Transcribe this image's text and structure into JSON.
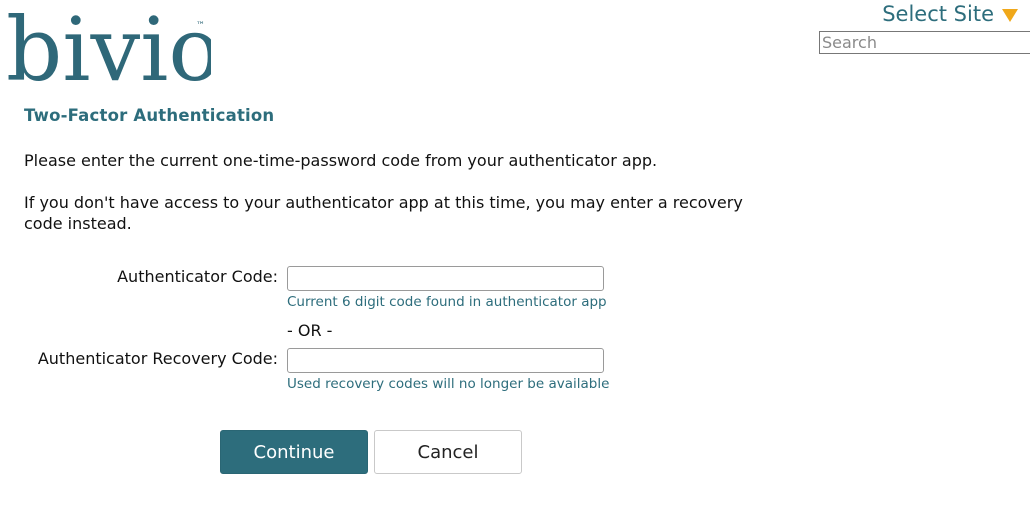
{
  "header": {
    "logo_text": "bivio",
    "logo_trademark": "™",
    "site_select_label": "Select Site",
    "search_placeholder": "Search"
  },
  "colors": {
    "brand_teal": "#2d6d7c",
    "accent_orange": "#f0a81a",
    "logo_blue": "#2f6879"
  },
  "form": {
    "title": "Two-Factor Authentication",
    "instruction_1": "Please enter the current one-time-password code from your authenticator app.",
    "instruction_2": "If you don't have access to your authenticator app at this time, you may enter a recovery code instead.",
    "auth_code_label": "Authenticator Code:",
    "auth_code_value": "",
    "auth_code_hint": "Current 6 digit code found in authenticator app",
    "or_text": "- OR -",
    "recovery_code_label": "Authenticator Recovery Code:",
    "recovery_code_value": "",
    "recovery_code_hint": "Used recovery codes will no longer be available",
    "continue_label": "Continue",
    "cancel_label": "Cancel"
  }
}
